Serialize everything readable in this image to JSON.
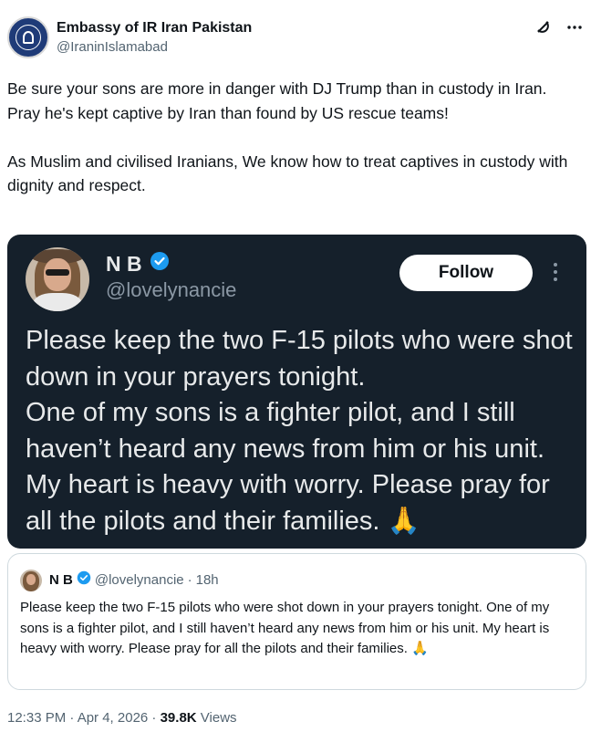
{
  "author": {
    "display_name": "Embassy of IR Iran Pakistan",
    "handle": "@IraninIslamabad",
    "avatar_icon": "iran-emblem-icon"
  },
  "header_icons": [
    "grok-icon",
    "more-options-icon"
  ],
  "tweet": {
    "paragraphs": [
      "Be sure your sons are more in danger with DJ Trump than in custody in Iran.",
      "Pray he's kept captive by Iran than found by US rescue teams!",
      "As Muslim and civilised Iranians, We know how to treat captives in custody with dignity and respect."
    ]
  },
  "media": {
    "name": "N B",
    "handle": "@lovelynancie",
    "follow_label": "Follow",
    "text": "Please keep the two F-15 pilots who were shot down in your prayers tonight.\nOne of my sons is a fighter pilot, and I still haven’t heard any news from him or his unit. My heart is heavy with worry. Please pray for all the pilots and their families. 🙏",
    "background": "#15202b"
  },
  "quote": {
    "name": "N B",
    "handle": "@lovelynancie",
    "separator": "·",
    "time": "18h",
    "text": "Please keep the two F-15 pilots who were shot down in your prayers tonight. One of my sons is a fighter pilot, and I still haven’t heard any news from him or his unit. My heart is heavy with worry. Please pray for all the pilots and their families. 🙏"
  },
  "meta": {
    "timestamp": "12:33 PM · Apr 4, 2026 · ",
    "views_count": "39.8K",
    "views_label": " Views"
  },
  "colors": {
    "text_primary": "#0f1419",
    "text_secondary": "#536471",
    "verified_blue": "#1d9bf0",
    "border": "#cfd9de"
  }
}
